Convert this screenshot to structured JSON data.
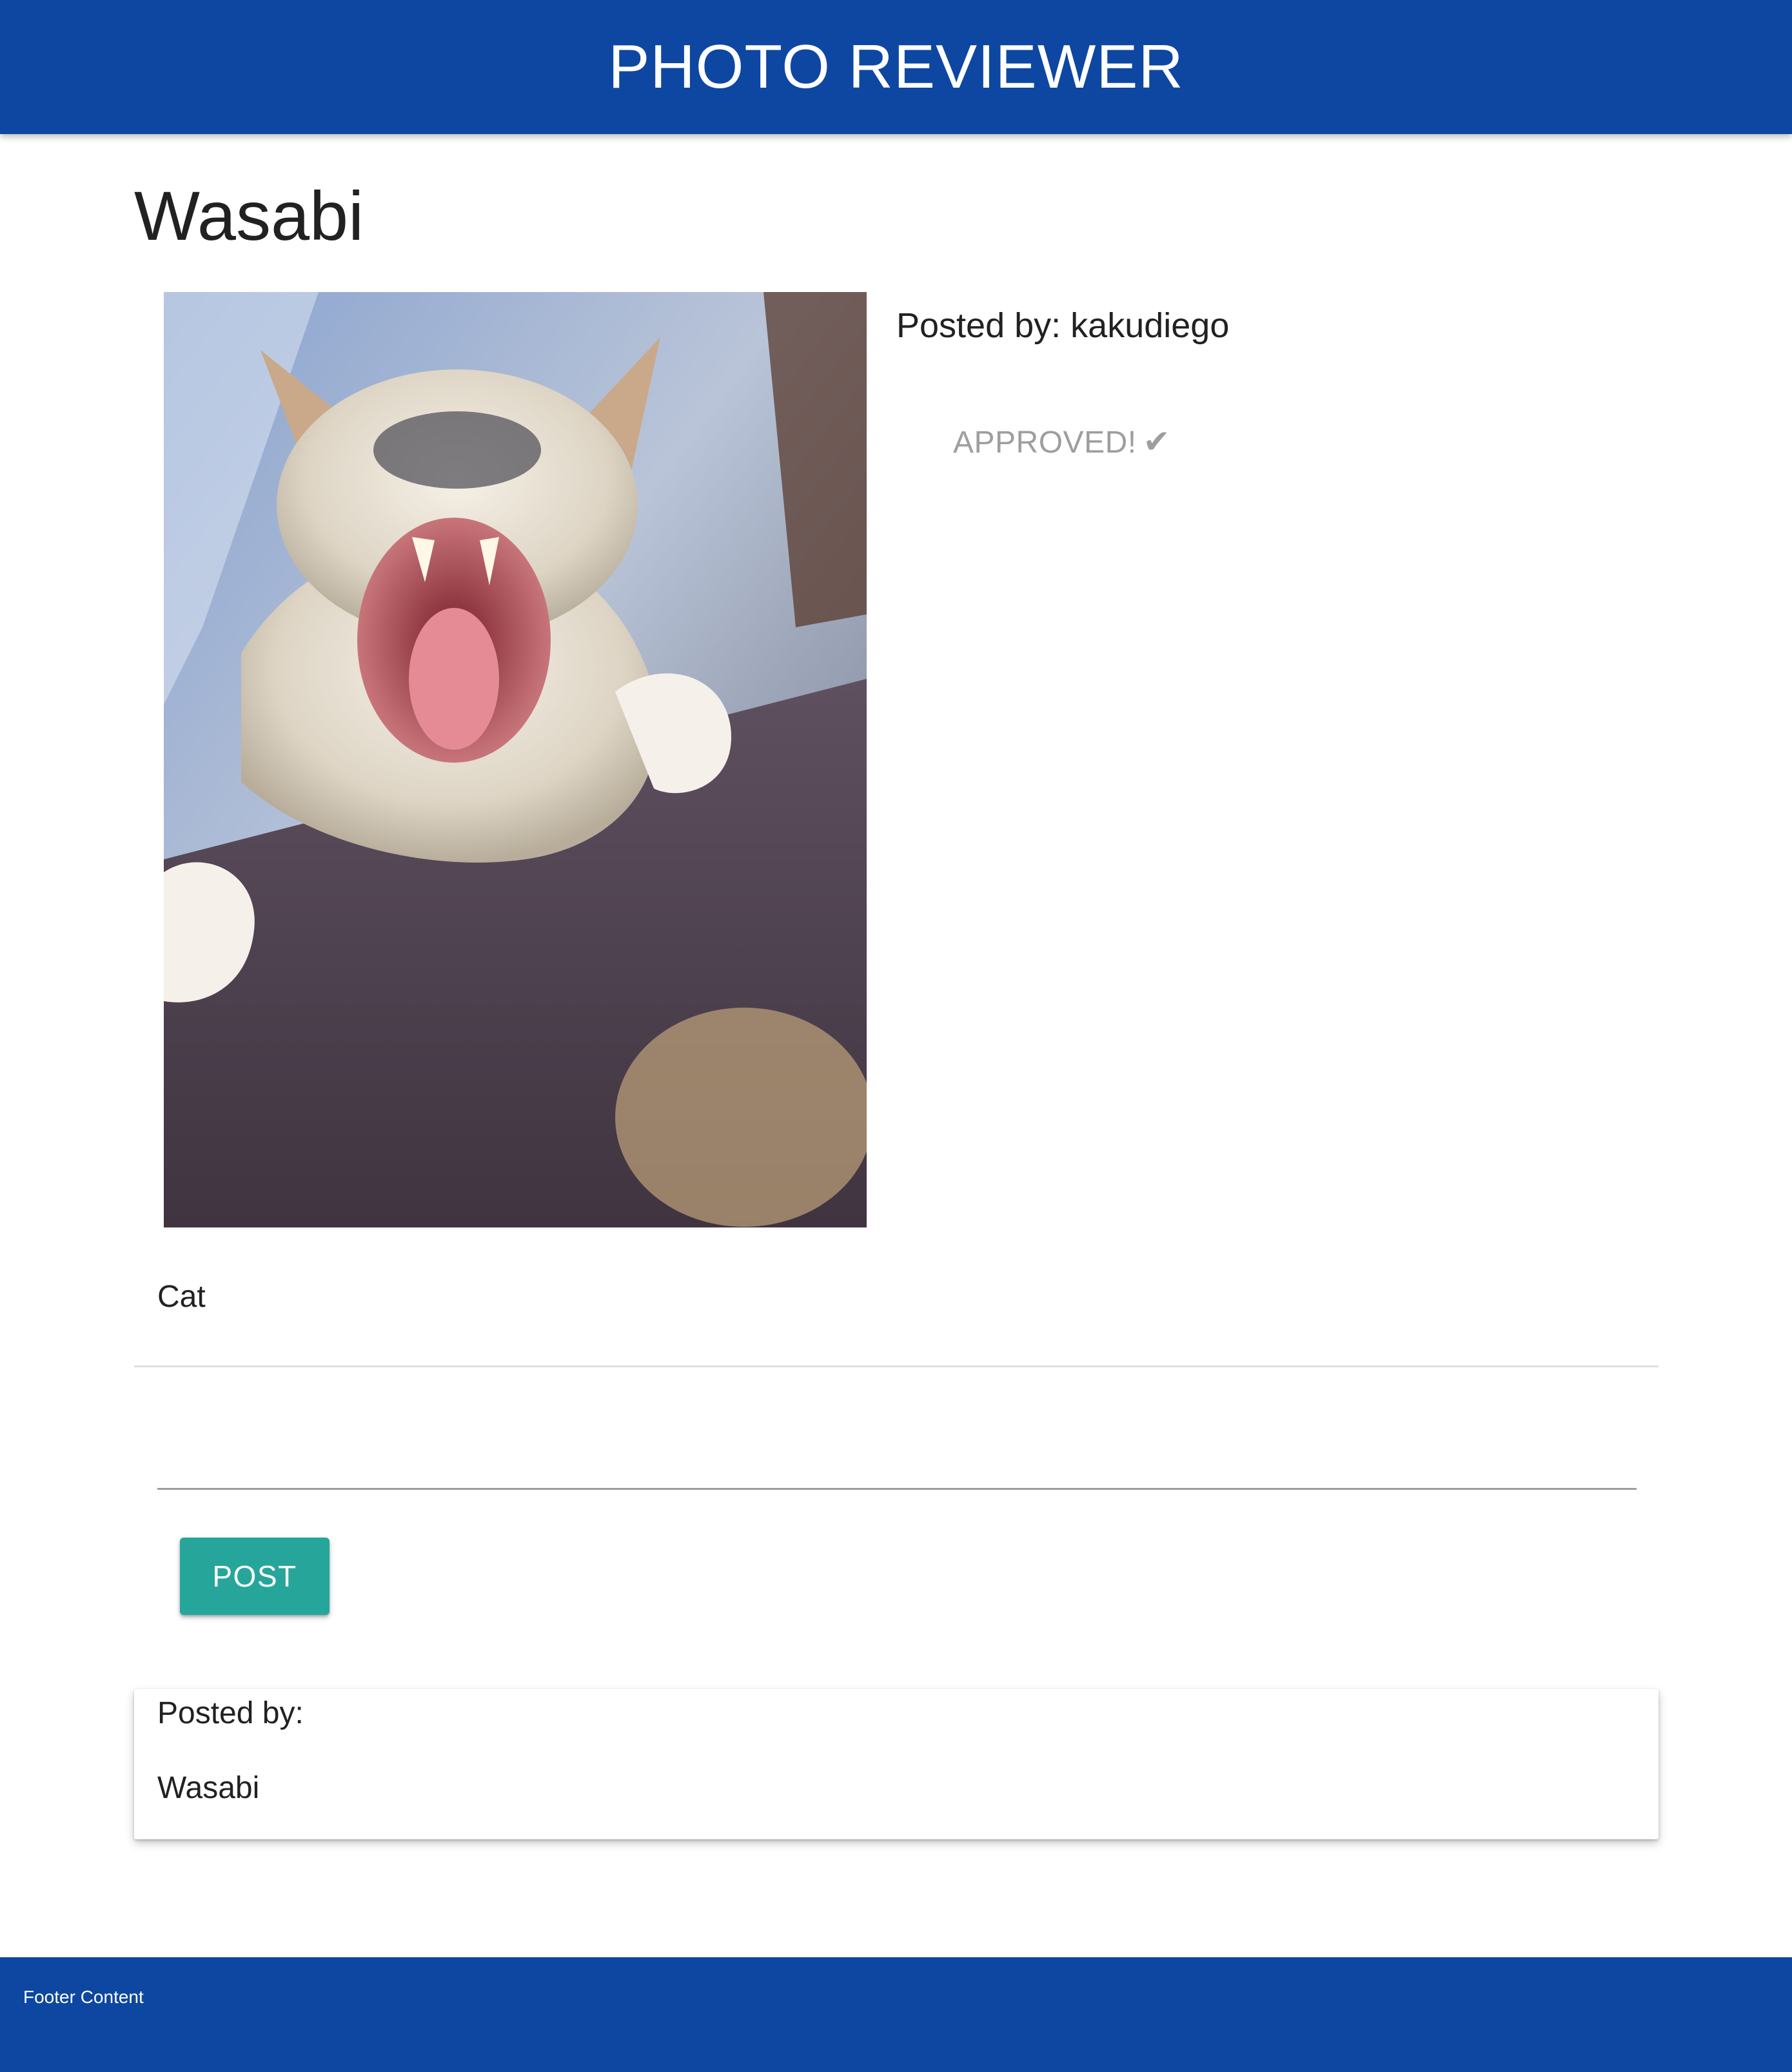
{
  "header": {
    "title": "PHOTO REVIEWER"
  },
  "photo": {
    "title": "Wasabi",
    "posted_by_label": "Posted by:",
    "posted_by_user": "kakudiego",
    "status": "APPROVED!",
    "status_icon": "check-icon",
    "caption": "Cat"
  },
  "comment_form": {
    "input_value": "",
    "post_label": "POST"
  },
  "comments": [
    {
      "author_label": "Posted by:",
      "text": "Wasabi"
    }
  ],
  "footer": {
    "text": "Footer Content"
  },
  "colors": {
    "primary": "#0d47a1",
    "accent": "#26a69a",
    "status_text": "#9e9e9e"
  }
}
